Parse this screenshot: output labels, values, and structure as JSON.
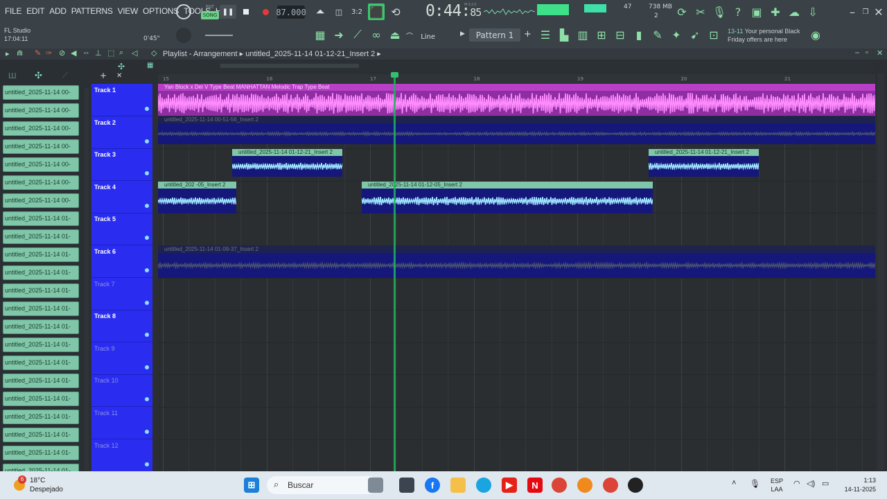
{
  "menu": [
    "FILE",
    "EDIT",
    "ADD",
    "PATTERNS",
    "VIEW",
    "OPTIONS",
    "TOOLS",
    "HELP"
  ],
  "transport": {
    "mode_top": "PAT",
    "mode_bottom": "SONG",
    "tempo": "87.000",
    "time_main": "0:44",
    "time_sub": "85",
    "time_unit": "M:S:CS"
  },
  "stats": {
    "cpu": "47",
    "memory": "738 MB",
    "poly": "2"
  },
  "project": {
    "name": "FL Studio",
    "time": "17:04:11",
    "position": "0'45\""
  },
  "toolbar2": {
    "snap": "Line",
    "pattern": "Pattern 1"
  },
  "promo": {
    "date": "13-11",
    "text1": "Your personal Black",
    "text2": "Friday offers are here"
  },
  "playlist": {
    "title": "Playlist - Arrangement",
    "breadcrumb": "untitled_2025-11-14 01-12-21_Insert 2"
  },
  "ruler": [
    "15",
    "16",
    "17",
    "18",
    "19",
    "20",
    "21"
  ],
  "picker_items": [
    "untitled_2025-11-14 00-",
    "untitled_2025-11-14 00-",
    "untitled_2025-11-14 00-",
    "untitled_2025-11-14 00-",
    "untitled_2025-11-14 00-",
    "untitled_2025-11-14 00-",
    "untitled_2025-11-14 00-",
    "untitled_2025-11-14 01-",
    "untitled_2025-11-14 01-",
    "untitled_2025-11-14 01-",
    "untitled_2025-11-14 01-",
    "untitled_2025-11-14 01-",
    "untitled_2025-11-14 01-",
    "untitled_2025-11-14 01-",
    "untitled_2025-11-14 01-",
    "untitled_2025-11-14 01-",
    "untitled_2025-11-14 01-",
    "untitled_2025-11-14 01-",
    "untitled_2025-11-14 01-",
    "untitled_2025-11-14 01-",
    "untitled_2025-11-14 01-",
    "untitled_2025-11-14 01-"
  ],
  "tracks": [
    {
      "name": "Track 1",
      "active": true
    },
    {
      "name": "Track 2",
      "active": true
    },
    {
      "name": "Track 3",
      "active": true
    },
    {
      "name": "Track 4",
      "active": true
    },
    {
      "name": "Track 5",
      "active": true
    },
    {
      "name": "Track 6",
      "active": true
    },
    {
      "name": "Track 7",
      "active": false
    },
    {
      "name": "Track 8",
      "active": true
    },
    {
      "name": "Track 9",
      "active": false
    },
    {
      "name": "Track 10",
      "active": false
    },
    {
      "name": "Track 11",
      "active": false
    },
    {
      "name": "Track 12",
      "active": false
    }
  ],
  "clips": {
    "t1": "Yan Block x Dei V Type Beat  MANHATTAN  Melodic Trap Type Beat",
    "t2": "untitled_2025-11-14 00-51-56_Insert 2",
    "t3a": "untitled_2025-11-14 01-12-21_Insert 2",
    "t3b": "untitled_2025-11-14 01-12-21_Insert 2",
    "t4a": "untitled_202 -05_Insert 2",
    "t4b": "untitled_2025-11-14 01-12-05_Insert 2",
    "t6": "untitled_2025-11-14 01-09-37_Insert 2"
  },
  "colors": {
    "track_header": "#2a2df0",
    "clip_pink": "#b93fc7",
    "clip_green": "#7fc7a8",
    "clip_navy": "#15187a",
    "playhead": "#1fb35e"
  },
  "taskbar": {
    "weather_temp": "18°C",
    "weather_desc": "Despejado",
    "search": "Buscar",
    "lang": "ESP",
    "layout": "LAA",
    "time": "1:13",
    "date": "14-11-2025",
    "badge": "6"
  }
}
